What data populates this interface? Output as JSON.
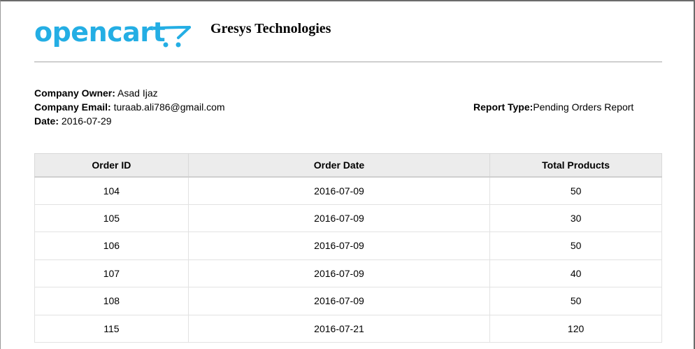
{
  "header": {
    "logo_text": "opencart",
    "company_name": "Gresys Technologies"
  },
  "colors": {
    "logo_blue": "#24aee4",
    "rule": "#a6a6a6",
    "table_header_bg": "#ececec"
  },
  "info": {
    "owner_label": "Company Owner:",
    "owner_value": "Asad Ijaz",
    "email_label": "Company Email:",
    "email_value": "turaab.ali786@gmail.com",
    "date_label": "Date:",
    "date_value": "2016-07-29",
    "report_type_label": "Report Type:",
    "report_type_value": "Pending Orders Report"
  },
  "table": {
    "columns": [
      "Order ID",
      "Order Date",
      "Total Products"
    ],
    "rows": [
      [
        "104",
        "2016-07-09",
        "50"
      ],
      [
        "105",
        "2016-07-09",
        "30"
      ],
      [
        "106",
        "2016-07-09",
        "50"
      ],
      [
        "107",
        "2016-07-09",
        "40"
      ],
      [
        "108",
        "2016-07-09",
        "50"
      ],
      [
        "115",
        "2016-07-21",
        "120"
      ]
    ]
  }
}
